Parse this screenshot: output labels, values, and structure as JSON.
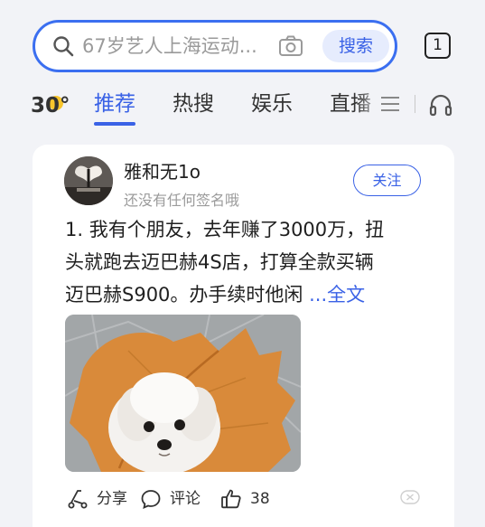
{
  "search": {
    "placeholder": "67岁艺人上海运动...",
    "button_label": "搜索",
    "tabs_count": "1"
  },
  "weather": {
    "temperature": "30°"
  },
  "channels": {
    "tabs": [
      {
        "label": "推荐",
        "active": true
      },
      {
        "label": "热搜",
        "active": false
      },
      {
        "label": "娱乐",
        "active": false
      },
      {
        "label": "直播",
        "active": false
      }
    ],
    "accent_color": "#3a62e6"
  },
  "post": {
    "author_name": "雅和无1o",
    "author_signature": "还没有任何签名哦",
    "follow_label": "关注",
    "text_lines": [
      "1. 我有个朋友，去年赚了3000万，扭",
      "头就跑去迈巴赫4S店，打算全款买辆",
      "迈巴赫S900。办手续时他闲 "
    ],
    "more_label": "...全文",
    "actions": {
      "share_label": "分享",
      "comment_label": "评论",
      "like_count": "38"
    }
  },
  "icons": {
    "search": "search-icon",
    "camera": "camera-icon",
    "menu": "menu-icon",
    "headphone": "headphone-icon",
    "share": "share-icon",
    "comment": "comment-icon",
    "like": "like-icon",
    "dismiss": "dismiss-icon"
  }
}
